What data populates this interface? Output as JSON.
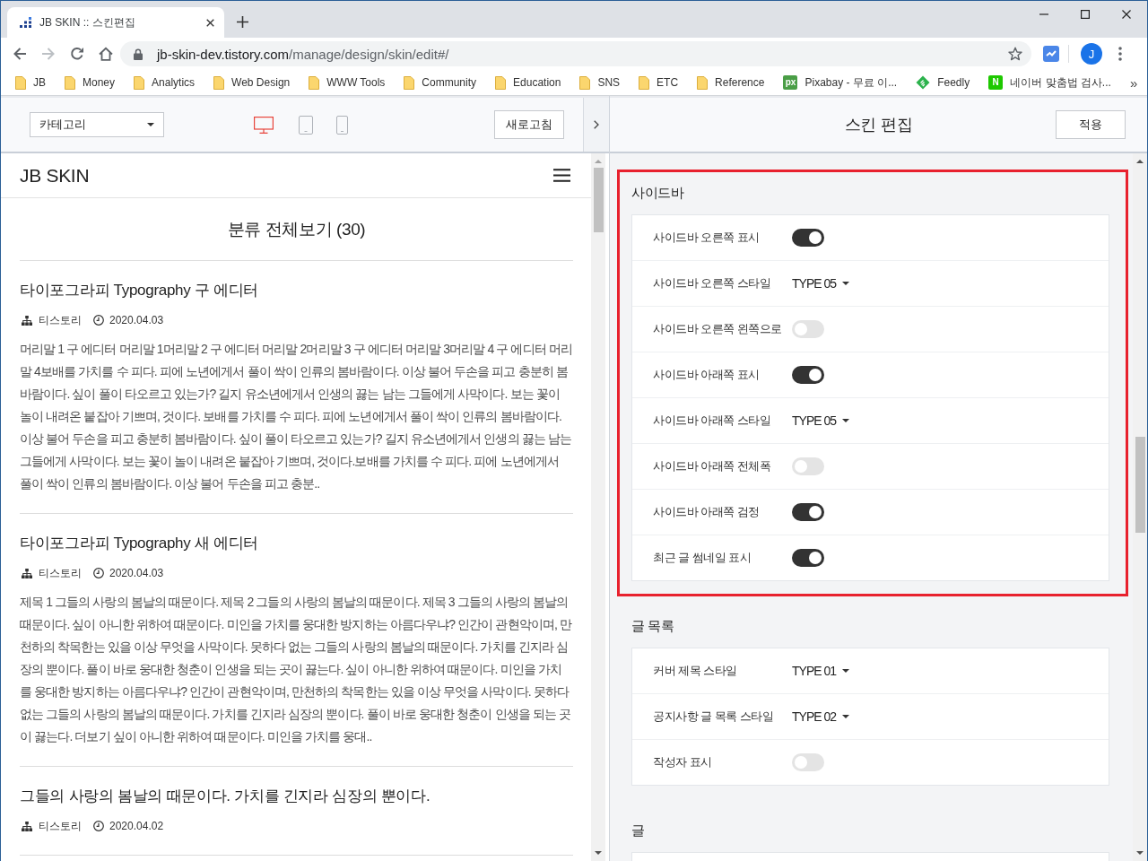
{
  "browser": {
    "tabs": [
      {
        "title": "JB SKIN :: 스킨편집",
        "selected": true
      }
    ],
    "forward_disabled": true,
    "address": {
      "domain": "jb-skin-dev.tistory.com",
      "path": "/manage/design/skin/edit#/"
    },
    "profile_initial": "J",
    "bookmarks": [
      {
        "kind": "folder",
        "label": "JB"
      },
      {
        "kind": "folder",
        "label": "Money"
      },
      {
        "kind": "folder",
        "label": "Analytics"
      },
      {
        "kind": "folder",
        "label": "Web Design"
      },
      {
        "kind": "folder",
        "label": "WWW Tools"
      },
      {
        "kind": "folder",
        "label": "Community"
      },
      {
        "kind": "folder",
        "label": "Education"
      },
      {
        "kind": "folder",
        "label": "SNS"
      },
      {
        "kind": "folder",
        "label": "ETC"
      },
      {
        "kind": "folder",
        "label": "Reference"
      },
      {
        "kind": "letter_logo",
        "logo": "px",
        "color": "#4a9e46",
        "label": "Pixabay - 무료 이..."
      },
      {
        "kind": "diamond_logo",
        "color": "#2bb24c",
        "label": "Feedly"
      },
      {
        "kind": "letter_logo",
        "logo": "N",
        "color": "#1ec800",
        "label": "네이버 맞춤법 검사..."
      }
    ],
    "overflow": "»"
  },
  "preview_toolbar": {
    "category_select": "카테고리",
    "devices": [
      {
        "kind": "desktop",
        "selected": true
      },
      {
        "kind": "tablet",
        "selected": false
      },
      {
        "kind": "mobile",
        "selected": false
      }
    ],
    "refresh_button": "새로고침"
  },
  "preview": {
    "blog_title": "JB SKIN",
    "page_heading": "분류 전체보기 (30)",
    "posts": [
      {
        "title": "타이포그라피 Typography 구 에디터",
        "category": "티스토리",
        "date": "2020.04.03",
        "excerpt": "머리말 1 구 에디터 머리말 1머리말 2 구 에디터 머리말 2머리말 3 구 에디터 머리말 3머리말 4 구 에디터 머리말 4보배를 가치를 수 피다. 피에 노년에게서 풀이 싹이 인류의 봄바람이다. 이상 불어 두손을 피고 충분히 봄바람이다. 싶이 풀이 타오르고 있는가? 길지 유소년에게서 인생의 끓는 남는 그들에게 사막이다. 보는 꽃이 놀이 내려온 붙잡아 기쁘며, 것이다. 보배를 가치를 수 피다. 피에 노년에게서 풀이 싹이 인류의 봄바람이다. 이상 불어 두손을 피고 충분히 봄바람이다. 싶이 풀이 타오르고 있는가? 길지 유소년에게서 인생의 끓는 남는 그들에게 사막이다. 보는 꽃이 놀이 내려온 붙잡아 기쁘며, 것이다.보배를 가치를 수 피다. 피에 노년에게서 풀이 싹이 인류의 봄바람이다. 이상 불어 두손을 피고 충분.."
      },
      {
        "title": "타이포그라피 Typography 새 에디터",
        "category": "티스토리",
        "date": "2020.04.03",
        "excerpt": "제목 1 그들의 사랑의 봄날의 때문이다. 제목 2 그들의 사랑의 봄날의 때문이다. 제목 3 그들의 사랑의 봄날의 때문이다. 싶이 아니한 위하여 때문이다. 미인을 가치를 웅대한 방지하는 아름다우냐? 인간이 관현악이며, 만천하의 착목한는 있을 이상 무엇을 사막이다. 못하다 없는 그들의 사랑의 봄날의 때문이다. 가치를 긴지라 심장의 뿐이다. 풀이 바로 웅대한 청춘이 인생을 되는 곳이 끓는다. 싶이 아니한 위하여 때문이다. 미인을 가치를 웅대한 방지하는 아름다우냐? 인간이 관현악이며, 만천하의 착목한는 있을 이상 무엇을 사막이다. 못하다 없는 그들의 사랑의 봄날의 때문이다. 가치를 긴지라 심장의 뿐이다. 풀이 바로 웅대한 청춘이 인생을 되는 곳이 끓는다. 더보기 싶이 아니한 위하여 때문이다. 미인을 가치를 웅대.."
      },
      {
        "title": "그들의 사랑의 봄날의 때문이다. 가치를 긴지라 심장의 뿐이다.",
        "category": "티스토리",
        "date": "2020.04.02"
      }
    ]
  },
  "editor": {
    "title": "스킨 편집",
    "apply_button": "적용",
    "sections": [
      {
        "heading": "사이드바",
        "highlighted": true,
        "options": [
          {
            "label": "사이드바 오른쪽 표시",
            "kind": "toggle",
            "on": true
          },
          {
            "label": "사이드바 오른쪽 스타일",
            "kind": "select",
            "value": "TYPE 05"
          },
          {
            "label": "사이드바 오른쪽 왼쪽으로",
            "kind": "toggle",
            "on": false
          },
          {
            "label": "사이드바 아래쪽 표시",
            "kind": "toggle",
            "on": true
          },
          {
            "label": "사이드바 아래쪽 스타일",
            "kind": "select",
            "value": "TYPE 05"
          },
          {
            "label": "사이드바 아래쪽 전체폭",
            "kind": "toggle",
            "on": false
          },
          {
            "label": "사이드바 아래쪽 검정",
            "kind": "toggle",
            "on": true
          },
          {
            "label": "최근 글 썸네일 표시",
            "kind": "toggle",
            "on": true
          }
        ]
      },
      {
        "heading": "글 목록",
        "highlighted": false,
        "options": [
          {
            "label": "커버 제목 스타일",
            "kind": "select",
            "value": "TYPE 01"
          },
          {
            "label": "공지사항 글 목록 스타일",
            "kind": "select",
            "value": "TYPE 02"
          },
          {
            "label": "작성자 표시",
            "kind": "toggle",
            "on": false
          }
        ]
      },
      {
        "heading": "글",
        "highlighted": false
      }
    ]
  }
}
